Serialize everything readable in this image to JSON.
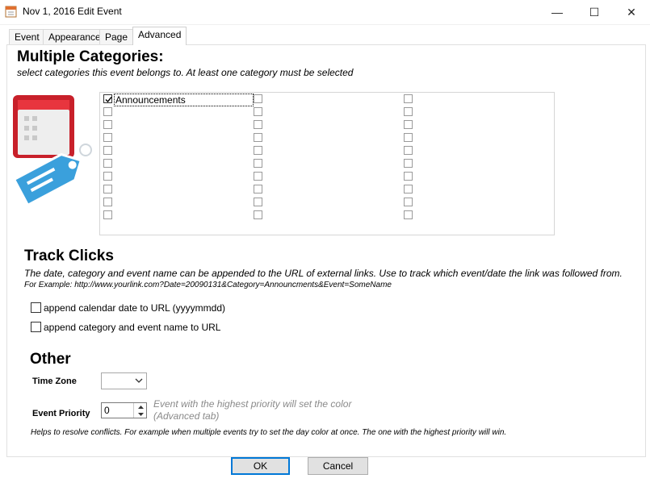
{
  "window": {
    "title": "Nov 1, 2016 Edit Event",
    "minimize_glyph": "—",
    "maximize_glyph": "☐",
    "close_glyph": "✕"
  },
  "tabs": [
    {
      "label": "Event"
    },
    {
      "label": "Appearance"
    },
    {
      "label": "Page"
    },
    {
      "label": "Advanced",
      "active": true
    }
  ],
  "categories": {
    "heading": "Multiple Categories:",
    "subtitle": "select categories this event belongs to. At least one category must be selected",
    "checked_item": "Announcements",
    "icon": "calendar-tag-icon"
  },
  "track_clicks": {
    "heading": "Track Clicks",
    "description": "The date, category and event name can be appended to the URL of external links. Use to track which event/date the link was followed from.",
    "example": "For Example: http://www.yourlink.com?Date=20090131&Category=Announcments&Event=SomeName",
    "option_date": "append calendar date to URL (yyyymmdd)",
    "option_category": "append category and event name to URL"
  },
  "other": {
    "heading": "Other",
    "timezone_label": "Time Zone",
    "timezone_value": "",
    "priority_label": "Event Priority",
    "priority_value": "0",
    "priority_hint_1": "Event with the highest priority will set the color",
    "priority_hint_2": "(Advanced tab)",
    "conflict_note": "Helps to resolve conflicts. For example when multiple events try to set the day color at once. The one with the highest priority will win."
  },
  "buttons": {
    "ok": "OK",
    "cancel": "Cancel"
  },
  "colors": {
    "accent": "#0078d7",
    "calendar_red": "#c8202a",
    "tag_blue": "#3aa0dc"
  }
}
